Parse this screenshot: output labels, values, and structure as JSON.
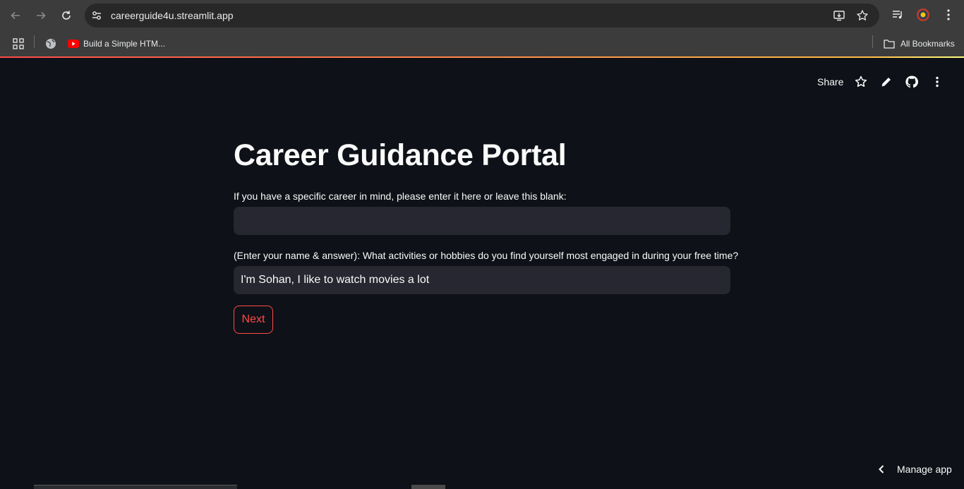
{
  "browser": {
    "url": "careerguide4u.streamlit.app",
    "bookmarks": [
      {
        "label": "Build a Simple HTM...",
        "icon": "youtube-icon"
      }
    ],
    "all_bookmarks_label": "All Bookmarks",
    "icons": [
      "back-icon",
      "forward-icon",
      "reload-icon",
      "site-settings-icon",
      "install-app-icon",
      "star-icon",
      "media-icon",
      "profile-avatar",
      "menu-icon",
      "apps-icon",
      "globe-icon",
      "folder-icon"
    ]
  },
  "header": {
    "share_label": "Share",
    "icons": [
      "star-icon",
      "edit-icon",
      "github-icon",
      "more-icon"
    ]
  },
  "main": {
    "title": "Career Guidance Portal",
    "fields": [
      {
        "label": "If you have a specific career in mind, please enter it here or leave this blank:",
        "value": "",
        "placeholder": ""
      },
      {
        "label": "(Enter your name & answer): What activities or hobbies do you find yourself most engaged in during your free time?",
        "value": "I'm Sohan, I like to watch movies a lot",
        "placeholder": ""
      }
    ],
    "next_label": "Next"
  },
  "footer": {
    "manage_app_label": "Manage app"
  },
  "colors": {
    "background": "#0e1117",
    "accent": "#ff4b4b",
    "input_bg": "#262730",
    "text": "#fafafa",
    "chrome": "#3c3c3c"
  }
}
